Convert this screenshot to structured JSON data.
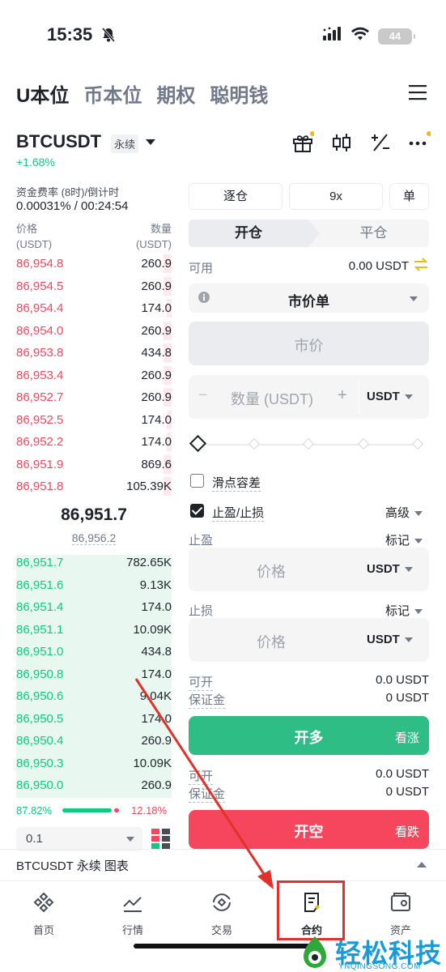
{
  "status": {
    "time": "15:35",
    "battery": "44"
  },
  "top_tabs": [
    "U本位",
    "币本位",
    "期权",
    "聪明钱"
  ],
  "symbol": {
    "name": "BTCUSDT",
    "badge": "永续",
    "change": "+1.68%"
  },
  "funding": {
    "label": "资金费率 (8时)/倒计时",
    "value": "0.00031% / 00:24:54"
  },
  "orderbook": {
    "price_header": "价格",
    "price_unit": "(USDT)",
    "qty_header": "数量",
    "qty_unit": "(USDT)",
    "asks": [
      {
        "price": "86,954.8",
        "qty": "260.9",
        "depth": 0.05
      },
      {
        "price": "86,954.5",
        "qty": "260.9",
        "depth": 0.05
      },
      {
        "price": "86,954.4",
        "qty": "174.0",
        "depth": 0.03
      },
      {
        "price": "86,954.0",
        "qty": "260.9",
        "depth": 0.05
      },
      {
        "price": "86,953.8",
        "qty": "434.8",
        "depth": 0.05
      },
      {
        "price": "86,953.4",
        "qty": "260.9",
        "depth": 0.05
      },
      {
        "price": "86,952.7",
        "qty": "260.9",
        "depth": 0.05
      },
      {
        "price": "86,952.5",
        "qty": "174.0",
        "depth": 0.03
      },
      {
        "price": "86,952.2",
        "qty": "174.0",
        "depth": 0.03
      },
      {
        "price": "86,951.9",
        "qty": "869.6",
        "depth": 0.05
      },
      {
        "price": "86,951.8",
        "qty": "105.39K",
        "depth": 0.05
      }
    ],
    "last_price": "86,951.7",
    "mark_price": "86,956.2",
    "bids": [
      {
        "price": "86,951.7",
        "qty": "782.65K"
      },
      {
        "price": "86,951.6",
        "qty": "9.13K"
      },
      {
        "price": "86,951.4",
        "qty": "174.0"
      },
      {
        "price": "86,951.1",
        "qty": "10.09K"
      },
      {
        "price": "86,951.0",
        "qty": "434.8"
      },
      {
        "price": "86,950.8",
        "qty": "174.0"
      },
      {
        "price": "86,950.6",
        "qty": "9.04K"
      },
      {
        "price": "86,950.5",
        "qty": "174.0"
      },
      {
        "price": "86,950.4",
        "qty": "260.9"
      },
      {
        "price": "86,950.3",
        "qty": "10.09K"
      },
      {
        "price": "86,950.0",
        "qty": "260.9"
      }
    ],
    "buy_ratio": "87.82%",
    "sell_ratio": "12.18%",
    "buy_fraction": 0.8782,
    "depth_step": "0.1"
  },
  "order_panel": {
    "margin_mode": "逐仓",
    "leverage": "9x",
    "position_mode": "单",
    "tab_open": "开仓",
    "tab_close": "平仓",
    "available_label": "可用",
    "available_value": "0.00 USDT",
    "order_type": "市价单",
    "price_placeholder": "市价",
    "qty_minus": "−",
    "qty_placeholder": "数量 (USDT)",
    "qty_plus": "+",
    "qty_unit": "USDT",
    "slippage_label": "滑点容差",
    "tpsl_label": "止盈/止损",
    "advanced_label": "高级",
    "tp_label": "止盈",
    "tp_trigger": "标记",
    "tp_placeholder": "价格",
    "tp_unit": "USDT",
    "sl_label": "止损",
    "sl_trigger": "标记",
    "sl_placeholder": "价格",
    "sl_unit": "USDT",
    "long_open_label": "可开",
    "long_open_value": "0.0 USDT",
    "long_margin_label": "保证金",
    "long_margin_value": "0 USDT",
    "long_button": "开多",
    "long_hint": "看涨",
    "short_open_label": "可开",
    "short_open_value": "0.0 USDT",
    "short_margin_label": "保证金",
    "short_margin_value": "0 USDT",
    "short_button": "开空",
    "short_hint": "看跌"
  },
  "chart_bar": "BTCUSDT 永续  图表",
  "nav": [
    "首页",
    "行情",
    "交易",
    "合约",
    "资产"
  ],
  "watermark": {
    "text": "轻松科技",
    "url": "YNQINGSONG.COM"
  },
  "colors": {
    "up": "#0ecb81",
    "down": "#f6465d",
    "accent": "#f0b90b",
    "annotation": "#e0312c"
  }
}
